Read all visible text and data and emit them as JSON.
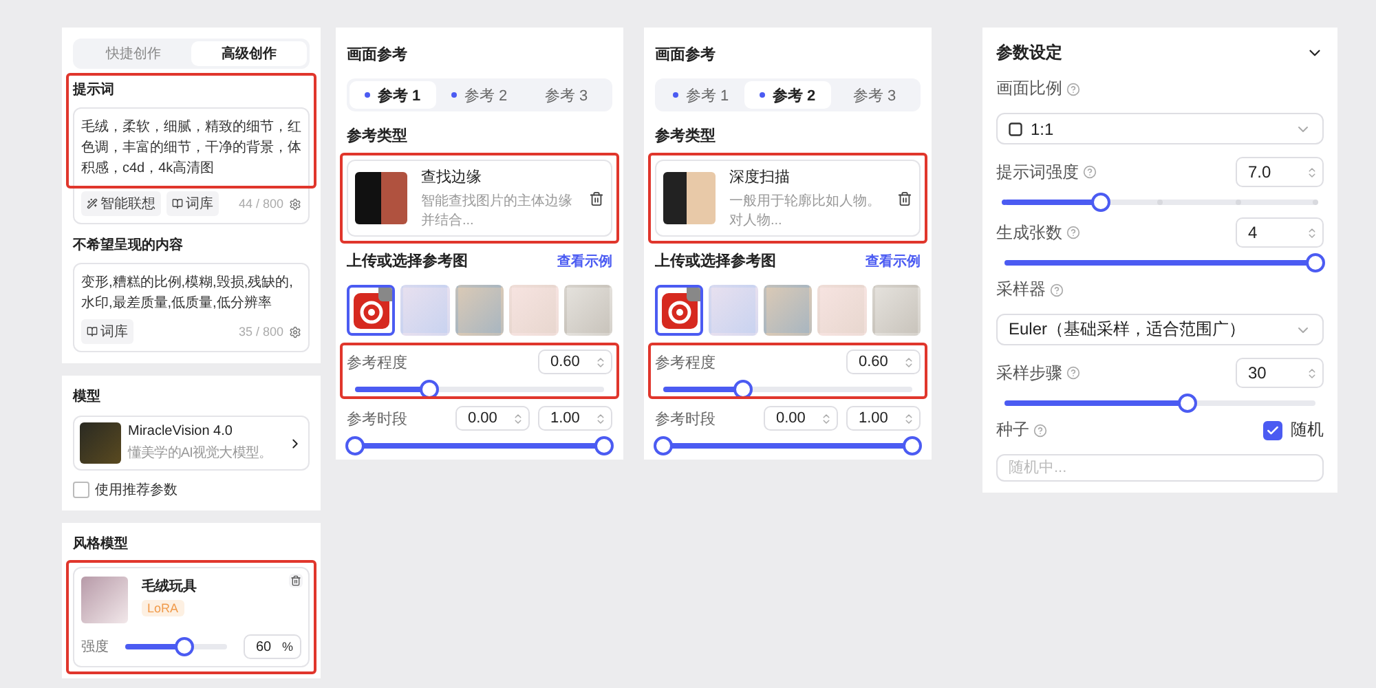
{
  "mode_tabs": [
    {
      "label": "快捷创作",
      "selected": false
    },
    {
      "label": "高级创作",
      "selected": true
    }
  ],
  "prompt": {
    "title": "提示词",
    "value": "毛绒，柔软，细腻，精致的细节，红色调，丰富的细节，干净的背景，体积感，c4d，4k高清图",
    "tools": [
      {
        "kind": "wand",
        "label": "智能联想"
      },
      {
        "kind": "book",
        "label": "词库"
      }
    ],
    "count": "44 / 800",
    "highlighted": true
  },
  "negative": {
    "title": "不希望呈现的内容",
    "value": "变形,糟糕的比例,模糊,毁损,残缺的,水印,最差质量,低质量,低分辨率",
    "tools": [
      {
        "kind": "book",
        "label": "词库"
      }
    ],
    "count": "35 / 800"
  },
  "model": {
    "title": "模型",
    "name": "MiracleVision 4.0",
    "description": "懂美学的AI视觉大模型。",
    "use_recommended": {
      "label": "使用推荐参数",
      "checked": false
    }
  },
  "style_model": {
    "title": "风格模型",
    "name": "毛绒玩具",
    "tag": "LoRA",
    "strength_label": "强度",
    "level": 0.58,
    "value": "60",
    "unit": "%",
    "highlighted": true
  },
  "reference_panels": [
    {
      "title": "画面参考",
      "tabs": [
        {
          "label": "参考 1",
          "selected": true,
          "marked": true
        },
        {
          "label": "参考 2",
          "selected": false,
          "marked": true
        },
        {
          "label": "参考 3",
          "selected": false,
          "marked": false
        }
      ],
      "type_title": "参考类型",
      "type": {
        "name": "查找边缘",
        "description": "智能查找图片的主体边缘并结合...",
        "highlighted": true
      },
      "upload_title": "上传或选择参考图",
      "examples_link": "查看示例",
      "images": [
        {
          "kind": "logo",
          "selected": true
        },
        {
          "kind": "photo",
          "selected": false
        },
        {
          "kind": "photo",
          "selected": false
        },
        {
          "kind": "photo",
          "selected": false
        },
        {
          "kind": "photo",
          "selected": false
        }
      ],
      "degree": {
        "label": "参考程度",
        "value": "0.60",
        "level": 0.3,
        "highlighted": true
      },
      "period": {
        "label": "参考时段",
        "start": "0.00",
        "end": "1.00",
        "thumbs": [
          {
            "level": 0
          },
          {
            "level": 1
          }
        ]
      }
    },
    {
      "title": "画面参考",
      "tabs": [
        {
          "label": "参考 1",
          "selected": false,
          "marked": true
        },
        {
          "label": "参考 2",
          "selected": true,
          "marked": true
        },
        {
          "label": "参考 3",
          "selected": false,
          "marked": false
        }
      ],
      "type_title": "参考类型",
      "type": {
        "name": "深度扫描",
        "description": "一般用于轮廓比如人物。对人物...",
        "highlighted": true
      },
      "upload_title": "上传或选择参考图",
      "examples_link": "查看示例",
      "images": [
        {
          "kind": "logo",
          "selected": true
        },
        {
          "kind": "photo",
          "selected": false
        },
        {
          "kind": "photo",
          "selected": false
        },
        {
          "kind": "photo",
          "selected": false
        },
        {
          "kind": "photo",
          "selected": false
        }
      ],
      "degree": {
        "label": "参考程度",
        "value": "0.60",
        "level": 0.32,
        "highlighted": true
      },
      "period": {
        "label": "参考时段",
        "start": "0.00",
        "end": "1.00",
        "thumbs": [
          {
            "level": 0
          },
          {
            "level": 1
          }
        ]
      }
    }
  ],
  "params": {
    "title": "参数设定",
    "expanded": true,
    "items": [
      {
        "kind": "select",
        "label": "画面比例",
        "value": "1:1",
        "with_square": true
      },
      {
        "kind": "number",
        "label": "提示词强度",
        "value": "7.0",
        "level": 0.31,
        "stepped": true
      },
      {
        "kind": "number",
        "label": "生成张数",
        "value": "4",
        "level": 1,
        "stepped": false
      },
      {
        "kind": "select",
        "label": "采样器",
        "value": "Euler（基础采样，适合范围广）",
        "with_square": false
      },
      {
        "kind": "number",
        "label": "采样步骤",
        "value": "30",
        "level": 0.59,
        "stepped": false
      },
      {
        "kind": "seed",
        "label": "种子",
        "checkbox": {
          "label": "随机",
          "checked": true
        },
        "placeholder": "随机中..."
      }
    ]
  }
}
